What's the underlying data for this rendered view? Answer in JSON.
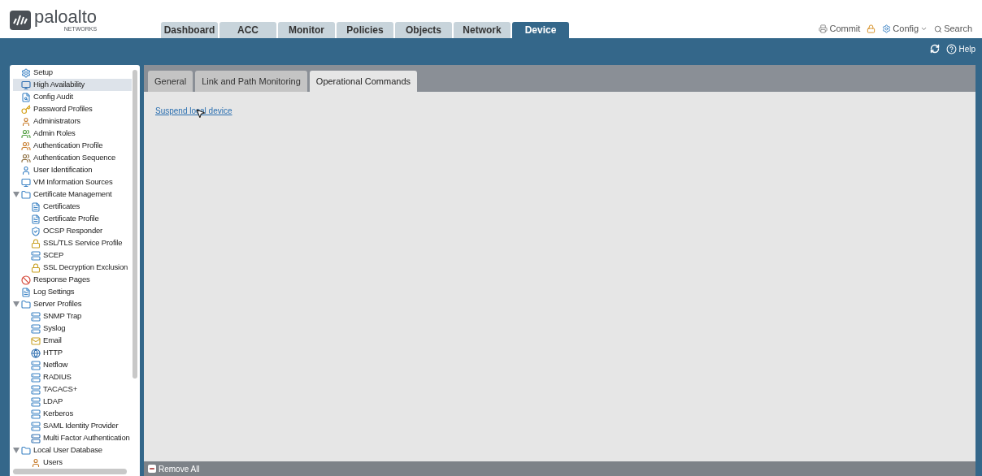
{
  "header": {
    "logo_text": "paloalto",
    "logo_subtext": "NETWORKS",
    "tabs": [
      {
        "label": "Dashboard",
        "selected": false
      },
      {
        "label": "ACC",
        "selected": false
      },
      {
        "label": "Monitor",
        "selected": false
      },
      {
        "label": "Policies",
        "selected": false
      },
      {
        "label": "Objects",
        "selected": false
      },
      {
        "label": "Network",
        "selected": false
      },
      {
        "label": "Device",
        "selected": true
      }
    ],
    "actions": [
      "Commit",
      "Config",
      "Search"
    ]
  },
  "toolbar": {
    "help": "Help"
  },
  "sidebar": {
    "items": [
      {
        "label": "Setup",
        "selected": false
      },
      {
        "label": "High Availability",
        "selected": true
      },
      {
        "label": "Config Audit",
        "selected": false
      },
      {
        "label": "Password Profiles",
        "selected": false
      },
      {
        "label": "Administrators",
        "selected": false
      },
      {
        "label": "Admin Roles",
        "selected": false
      },
      {
        "label": "Authentication Profile",
        "selected": false
      },
      {
        "label": "Authentication Sequence",
        "selected": false
      },
      {
        "label": "User Identification",
        "selected": false
      },
      {
        "label": "VM Information Sources",
        "selected": false
      },
      {
        "label": "Certificate Management",
        "selected": false,
        "expanded": true,
        "children": [
          {
            "label": "Certificates",
            "selected": false
          },
          {
            "label": "Certificate Profile",
            "selected": false
          },
          {
            "label": "OCSP Responder",
            "selected": false
          },
          {
            "label": "SSL/TLS Service Profile",
            "selected": false
          },
          {
            "label": "SCEP",
            "selected": false
          },
          {
            "label": "SSL Decryption Exclusion",
            "selected": false
          }
        ]
      },
      {
        "label": "Response Pages",
        "selected": false
      },
      {
        "label": "Log Settings",
        "selected": false
      },
      {
        "label": "Server Profiles",
        "selected": false,
        "expanded": true,
        "children": [
          {
            "label": "SNMP Trap",
            "selected": false
          },
          {
            "label": "Syslog",
            "selected": false
          },
          {
            "label": "Email",
            "selected": false
          },
          {
            "label": "HTTP",
            "selected": false
          },
          {
            "label": "Netflow",
            "selected": false
          },
          {
            "label": "RADIUS",
            "selected": false
          },
          {
            "label": "TACACS+",
            "selected": false
          },
          {
            "label": "LDAP",
            "selected": false
          },
          {
            "label": "Kerberos",
            "selected": false
          },
          {
            "label": "SAML Identity Provider",
            "selected": false
          },
          {
            "label": "Multi Factor Authentication",
            "selected": false
          }
        ]
      },
      {
        "label": "Local User Database",
        "selected": false,
        "expanded": true,
        "children": [
          {
            "label": "Users",
            "selected": false
          }
        ]
      }
    ]
  },
  "content": {
    "tabs": [
      {
        "label": "General",
        "selected": false
      },
      {
        "label": "Link and Path Monitoring",
        "selected": false
      },
      {
        "label": "Operational Commands",
        "selected": true
      }
    ],
    "link": "Suspend local device"
  },
  "footer": {
    "button": "Remove All"
  }
}
